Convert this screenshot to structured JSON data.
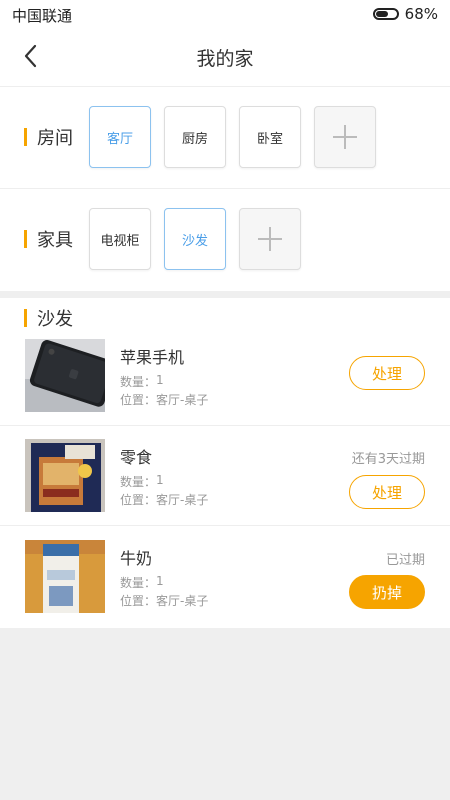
{
  "status_bar": {
    "carrier": "中国联通",
    "battery": "68%"
  },
  "nav": {
    "title": "我的家"
  },
  "rooms": {
    "label": "房间",
    "items": [
      {
        "label": "客厅",
        "selected": true
      },
      {
        "label": "厨房",
        "selected": false
      },
      {
        "label": "卧室",
        "selected": false
      }
    ]
  },
  "furniture": {
    "label": "家具",
    "items": [
      {
        "label": "电视柜",
        "selected": false
      },
      {
        "label": "沙发",
        "selected": true
      }
    ]
  },
  "list": {
    "title": "沙发",
    "qty_label": "数量：",
    "loc_label": "位置：",
    "items": [
      {
        "name": "苹果手机",
        "qty": "1",
        "location": "客厅-桌子",
        "status": "",
        "action": "处理",
        "action_style": "outline"
      },
      {
        "name": "零食",
        "qty": "1",
        "location": "客厅-桌子",
        "status": "还有3天过期",
        "action": "处理",
        "action_style": "outline"
      },
      {
        "name": "牛奶",
        "qty": "1",
        "location": "客厅-桌子",
        "status": "已过期",
        "action": "扔掉",
        "action_style": "filled"
      }
    ]
  },
  "colors": {
    "accent": "#f6a400",
    "selected_blue": "#4a9ee8",
    "background": "#efefef"
  }
}
